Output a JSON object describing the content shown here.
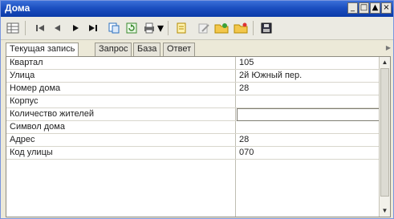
{
  "window": {
    "title": "Дома"
  },
  "titlebar": {
    "minimize": "_",
    "maximize": "□",
    "scroll_up": "▲",
    "close": "×"
  },
  "toolbar": {
    "icons": [
      "grid-icon",
      "first-record-icon",
      "previous-record-icon",
      "next-record-icon",
      "last-record-icon",
      "copy-icon",
      "refresh-icon",
      "print-icon",
      "dropdown-icon",
      "new-record-icon",
      "edit-icon",
      "folder-add-icon",
      "folder-open-icon",
      "save-icon"
    ],
    "dropdown_arrow": "▾"
  },
  "tabs": [
    {
      "label": "Текущая запись",
      "active": true
    },
    {
      "label": "Запрос",
      "active": false
    },
    {
      "label": "База",
      "active": false
    },
    {
      "label": "Ответ",
      "active": false
    }
  ],
  "table": {
    "rows": [
      {
        "label": "Квартал",
        "value": "105"
      },
      {
        "label": "Улица",
        "value": "2й Южный пер."
      },
      {
        "label": "Номер дома",
        "value": "28"
      },
      {
        "label": "Корпус",
        "value": ""
      },
      {
        "label": "Количество жителей",
        "value": ""
      },
      {
        "label": "Символ дома",
        "value": ""
      },
      {
        "label": "Адрес",
        "value": "28"
      },
      {
        "label": "Код улицы",
        "value": "070"
      }
    ]
  },
  "scrollbar": {
    "up": "▲",
    "down": "▼"
  },
  "tabs_scroll_arrow": "▶"
}
